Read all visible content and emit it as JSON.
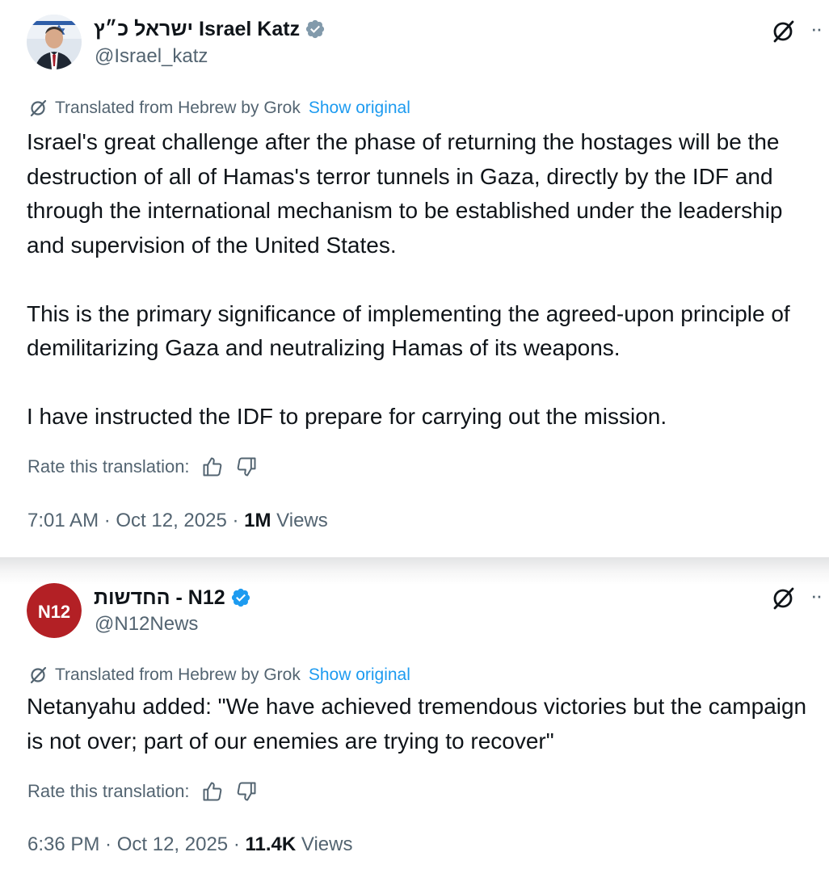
{
  "tweets": [
    {
      "display_name": "ישראל כ״ץ Israel Katz",
      "handle": "@Israel_katz",
      "translated_label": "Translated from Hebrew by Grok",
      "show_original": "Show original",
      "paragraphs": [
        "Israel's great challenge after the phase of returning the hostages will be the destruction of all of Hamas's terror tunnels in Gaza, directly by the IDF and through the international mechanism to be established under the leadership and supervision of the United States.",
        "This is the primary significance of implementing the agreed-upon principle of demilitarizing Gaza and neutralizing Hamas of its weapons.",
        "I have instructed the IDF to prepare for carrying out the mission."
      ],
      "rate_label": "Rate this translation:",
      "time": "7:01 AM",
      "date": "Oct 12, 2025",
      "views_count": "1M",
      "views_label": "Views"
    },
    {
      "display_name": "החדשות - N12",
      "handle": "@N12News",
      "avatar_text": "N12",
      "translated_label": "Translated from Hebrew by Grok",
      "show_original": "Show original",
      "paragraphs": [
        "Netanyahu added: \"We have achieved tremendous victories but the campaign is not over; part of our enemies are trying to recover\""
      ],
      "rate_label": "Rate this translation:",
      "time": "6:36 PM",
      "date": "Oct 12, 2025",
      "views_count": "11.4K",
      "views_label": "Views"
    }
  ],
  "separator": " · ",
  "icons": {
    "verified": "verified-badge-icon",
    "grok": "grok-icon",
    "more": "more-icon",
    "thumbs_up": "thumbs-up-icon",
    "thumbs_down": "thumbs-down-icon"
  },
  "colors": {
    "text": "#0f1419",
    "secondary": "#536471",
    "link": "#1d9bf0",
    "verified": "#1d9bf0",
    "n12_red": "#b32025"
  }
}
